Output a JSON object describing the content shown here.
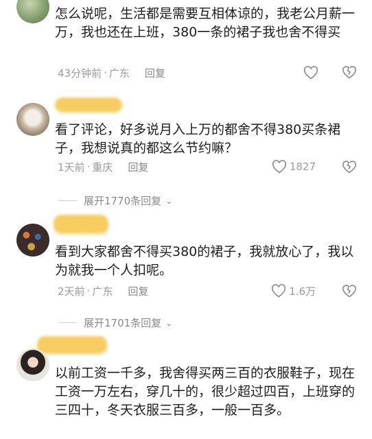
{
  "comments": [
    {
      "text": "怎么说呢，生活都是需要互相体谅的，我老公月薪一万，我也还在上班，380一条的裙子我也舍不得买",
      "time": "43分钟前",
      "region": "广东",
      "reply": "回复",
      "likes": ""
    },
    {
      "text": "看了评论，好多说月入上万的都舍不得380买条裙子，我想说真的都这么节约嘛？",
      "time": "1天前",
      "region": "重庆",
      "reply": "回复",
      "likes": "1827",
      "expand": "展开1770条回复"
    },
    {
      "text": "看到大家都舍不得买380的裙子，我就放心了，我以为就我一个人扣呢。",
      "time": "2天前",
      "region": "广东",
      "reply": "回复",
      "likes": "1.6万",
      "expand": "展开1701条回复"
    },
    {
      "text": "以前工资一千多，我舍得买两三百的衣服鞋子，现在工资一万左右，穿几十的，很少超过四百，上班穿的三四十，冬天衣服三百多，一般一百多。"
    }
  ],
  "separator": "·",
  "colors": {
    "username_blur": "#f6c445",
    "meta_text": "#9a9a9a"
  }
}
